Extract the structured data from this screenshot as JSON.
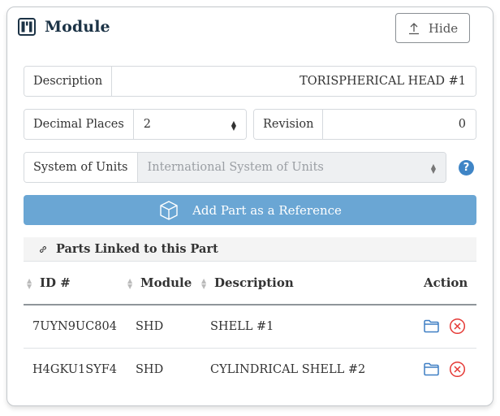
{
  "module": {
    "title": "Module",
    "title_icon": "kanban-board-icon",
    "hide_button": {
      "label": "Hide",
      "icon": "upload-arrow-icon"
    }
  },
  "form": {
    "description": {
      "label": "Description",
      "value": "TORISPHERICAL HEAD #1"
    },
    "decimal_places": {
      "label": "Decimal Places",
      "value": "2"
    },
    "revision": {
      "label": "Revision",
      "value": "0"
    },
    "system_of_units": {
      "label": "System of Units",
      "value": "International System of Units",
      "help_icon": "question-circle-icon",
      "help_label": "?"
    }
  },
  "add_reference_button": {
    "label": "Add Part as a Reference",
    "icon": "box-icon"
  },
  "linked_parts": {
    "header": "Parts Linked to this Part",
    "header_icon": "link-icon",
    "columns": [
      "ID #",
      "Module",
      "Description",
      "Action"
    ],
    "rows": [
      {
        "id": "7UYN9UC804",
        "module": "SHD",
        "description": "SHELL #1"
      },
      {
        "id": "H4GKU1SYF4",
        "module": "SHD",
        "description": "CYLINDRICAL SHELL #2"
      }
    ],
    "actions": {
      "open_icon": "folder-icon",
      "remove_icon": "remove-circle-icon"
    }
  },
  "colors": {
    "primary": "#6aa6d4",
    "title": "#1c3346",
    "help": "#3f85c6",
    "folder": "#3f7fc4",
    "remove": "#e53935"
  }
}
